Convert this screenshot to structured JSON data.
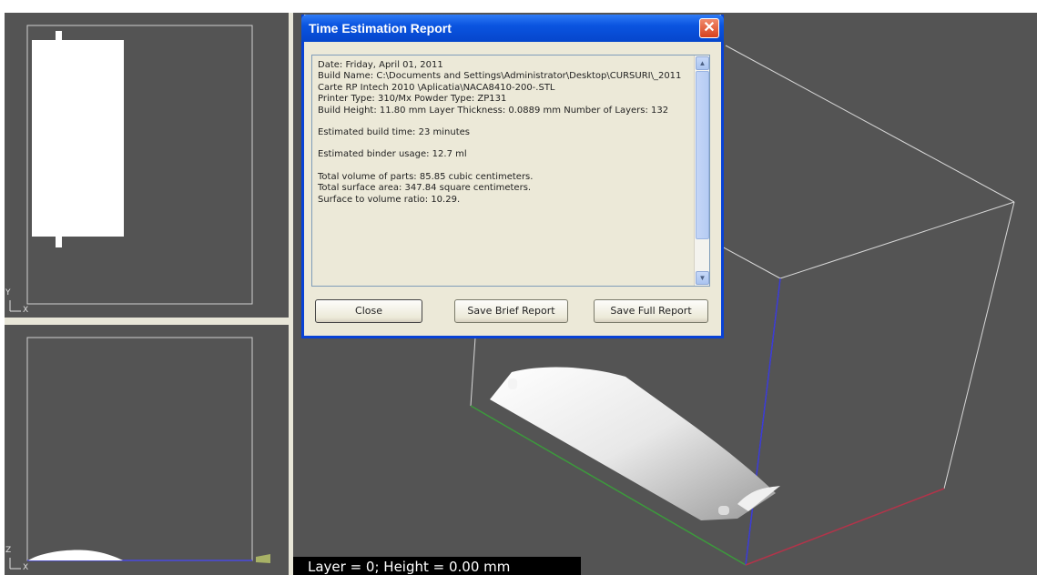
{
  "dialog": {
    "title": "Time Estimation Report",
    "close_glyph": "✕",
    "report_lines": [
      "Date: Friday, April 01, 2011",
      "Build Name: C:\\Documents and Settings\\Administrator\\Desktop\\CURSURI\\_2011 Carte RP Intech 2010 \\Aplicatia\\NACA8410-200-.STL",
      "Printer Type: 310/Mx     Powder Type: ZP131",
      "Build Height: 11.80 mm     Layer Thickness: 0.0889 mm     Number of Layers: 132",
      "",
      "Estimated build time:  23 minutes",
      "",
      "Estimated binder usage:  12.7 ml",
      "",
      "Total volume of parts: 85.85 cubic centimeters.",
      "Total surface area: 347.84 square centimeters.",
      "Surface to volume ratio: 10.29."
    ],
    "buttons": {
      "close": "Close",
      "save_brief": "Save Brief Report",
      "save_full": "Save Full Report"
    }
  },
  "viewports": {
    "top": {
      "axis_v": "Y",
      "axis_h": "X"
    },
    "bottom": {
      "axis_v": "Z",
      "axis_h": "X"
    },
    "main": {
      "status": "Layer = 0; Height = 0.00 mm"
    }
  },
  "colors": {
    "viewport_bg": "#545454",
    "dialog_title_blue": "#0a54e0",
    "axis_green": "#3c9a3c",
    "axis_blue": "#3a3ad8",
    "axis_red": "#b2344a"
  },
  "icons": {
    "close": "close-icon",
    "scroll_up": "scroll-up-icon",
    "scroll_down": "scroll-down-icon"
  }
}
